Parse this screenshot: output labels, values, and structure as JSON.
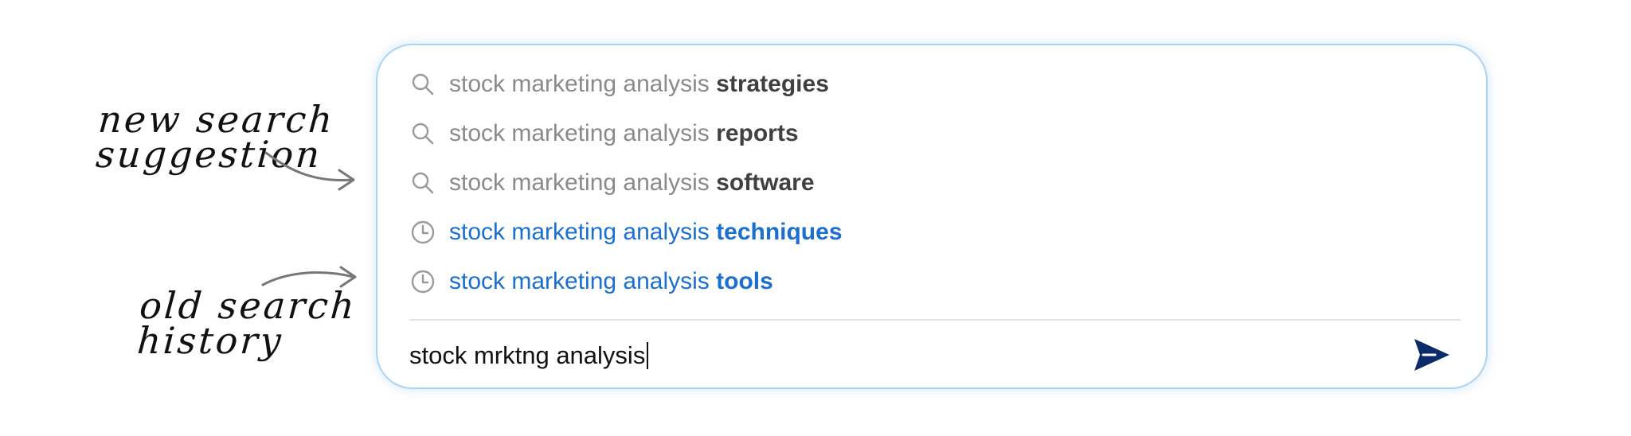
{
  "annotations": {
    "new_suggestion": "new search\nsuggestion",
    "old_history": "old search\nhistory"
  },
  "colors": {
    "panel_border": "#a9d4f5",
    "new_prefix": "#8a8a8a",
    "new_suffix": "#404040",
    "history_text": "#1a6fd1",
    "send_icon": "#0d2a6b"
  },
  "suggestions": [
    {
      "type": "new",
      "icon": "search-icon",
      "prefix": "stock marketing analysis ",
      "suffix": "strategies"
    },
    {
      "type": "new",
      "icon": "search-icon",
      "prefix": "stock marketing analysis ",
      "suffix": "reports"
    },
    {
      "type": "new",
      "icon": "search-icon",
      "prefix": "stock marketing analysis ",
      "suffix": "software"
    },
    {
      "type": "history",
      "icon": "history-clock-icon",
      "prefix": "stock marketing analysis ",
      "suffix": "techniques"
    },
    {
      "type": "history",
      "icon": "history-clock-icon",
      "prefix": "stock marketing analysis ",
      "suffix": "tools"
    }
  ],
  "search": {
    "value": "stock mrktng analysis",
    "send_icon": "send-icon"
  }
}
